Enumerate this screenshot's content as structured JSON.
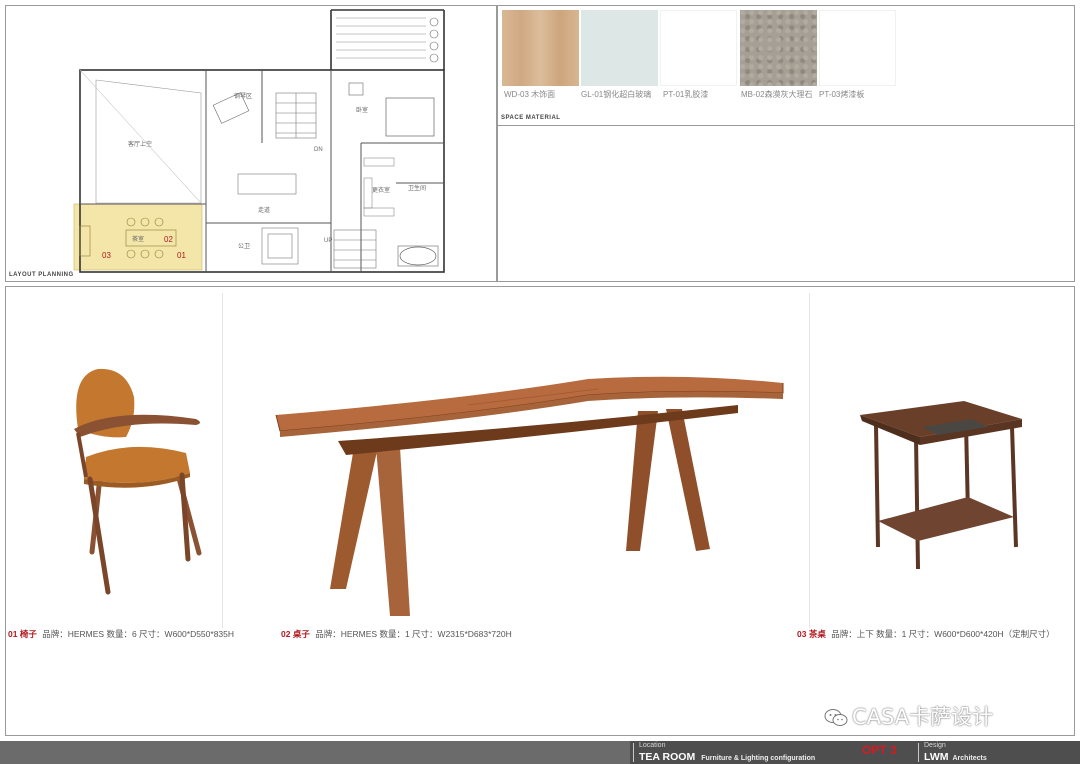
{
  "layout_panel": {
    "label": "LAYOUT  PLANNING",
    "rooms": {
      "living": "客厅上空",
      "piano": "钢琴区",
      "bedroom": "卧室",
      "corridor": "走道",
      "dn": "DN",
      "up": "UP",
      "cloak": "更衣室",
      "bath": "卫生间",
      "tea": "茶室",
      "powder": "公卫",
      "n01": "01",
      "n02": "02",
      "n03": "03"
    }
  },
  "materials": {
    "label": "SPACE  MATERIAL",
    "items": [
      {
        "code": "WD-03 木饰面",
        "color": "#d7b491"
      },
      {
        "code": "GL-01钢化超白玻璃",
        "color": "#dfe8e6"
      },
      {
        "code": "PT-01乳胶漆",
        "color": "#ffffff"
      },
      {
        "code": "MB-02森漠灰大理石",
        "color": "#a59f95"
      },
      {
        "code": "PT-03烤漆板",
        "color": "#ffffff"
      }
    ]
  },
  "furniture": [
    {
      "num": "01",
      "name": "椅子",
      "spec": "品牌：HERMES  数量：6  尺寸：W600*D550*835H"
    },
    {
      "num": "02",
      "name": "桌子",
      "spec": "品牌：HERMES  数量：1  尺寸：W2315*D683*720H"
    },
    {
      "num": "03",
      "name": "茶桌",
      "spec": "品牌：上下  数量：1  尺寸：W600*D600*420H（定制尺寸）"
    }
  ],
  "watermark": "CASA卡萨设计",
  "footer": {
    "location_label": "Location",
    "location": "TEA ROOM",
    "subtitle": "Furniture & Lighting configuration",
    "option": "OPT 3",
    "design_label": "Design",
    "design": "LWM",
    "design_sub": "Architects"
  },
  "colors": {
    "accent": "#b0191e",
    "option": "#d21c22",
    "footer_dark": "#4e4e4e",
    "footer_mid": "#6b6b6b",
    "highlight": "#f3e6a8",
    "leather": "#c06a3e",
    "walnut": "#7a4a2c"
  }
}
